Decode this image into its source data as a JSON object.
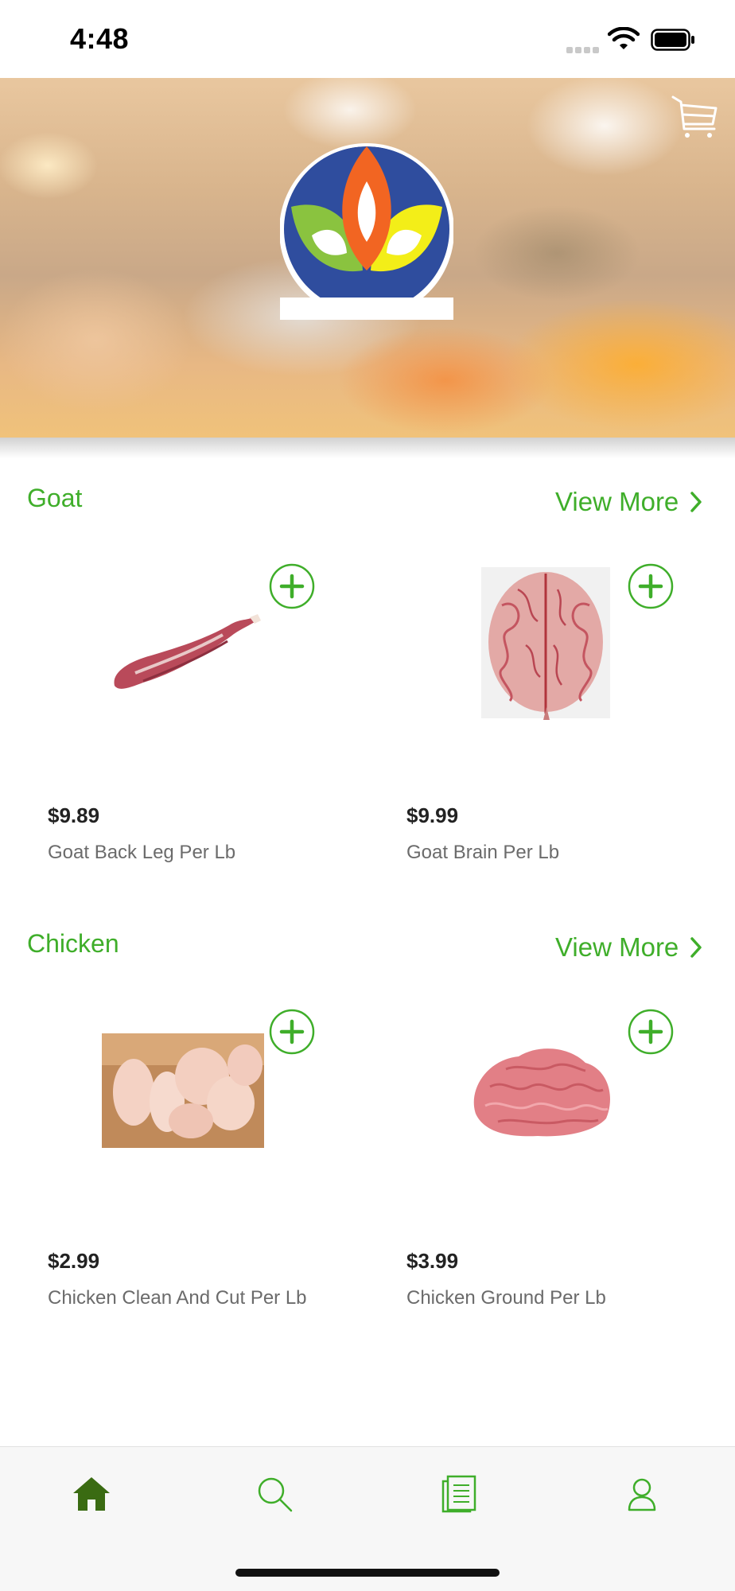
{
  "status_bar": {
    "time": "4:48"
  },
  "header": {
    "logo": "store-logo",
    "cart_icon": "cart-icon"
  },
  "sections": [
    {
      "title": "Goat",
      "view_more": "View More",
      "products": [
        {
          "price": "$9.89",
          "name": "Goat Back Leg Per Lb",
          "image": "goat-back-leg-image"
        },
        {
          "price": "$9.99",
          "name": "Goat Brain Per Lb",
          "image": "goat-brain-image"
        }
      ]
    },
    {
      "title": "Chicken",
      "view_more": "View More",
      "products": [
        {
          "price": "$2.99",
          "name": "Chicken Clean And Cut Per Lb",
          "image": "chicken-cut-image"
        },
        {
          "price": "$3.99",
          "name": "Chicken Ground Per Lb",
          "image": "ground-meat-image"
        }
      ]
    }
  ],
  "tab_bar": {
    "tabs": [
      {
        "icon": "home-icon",
        "active": true
      },
      {
        "icon": "search-icon",
        "active": false
      },
      {
        "icon": "orders-icon",
        "active": false
      },
      {
        "icon": "profile-icon",
        "active": false
      }
    ]
  },
  "colors": {
    "accent": "#3fae2a",
    "active_tab": "#3a6b12",
    "text_dark": "#222222",
    "text_muted": "#6b6b6b"
  }
}
